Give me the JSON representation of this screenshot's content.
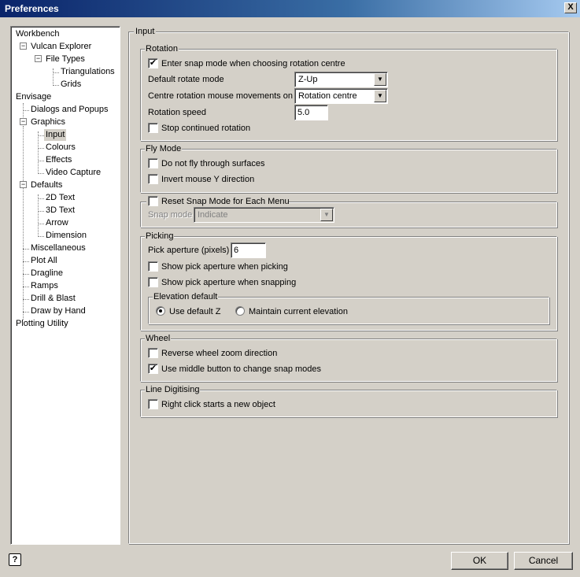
{
  "window": {
    "title": "Preferences",
    "close_glyph": "X"
  },
  "tree": {
    "items": [
      {
        "label": "Workbench"
      },
      {
        "label": "Vulcan Explorer",
        "expander": "−"
      },
      {
        "label": "File Types",
        "expander": "−"
      },
      {
        "label": "Triangulations"
      },
      {
        "label": "Grids"
      },
      {
        "label": "Envisage"
      },
      {
        "label": "Dialogs and Popups"
      },
      {
        "label": "Graphics",
        "expander": "−"
      },
      {
        "label": "Input",
        "selected": true
      },
      {
        "label": "Colours"
      },
      {
        "label": "Effects"
      },
      {
        "label": "Video Capture"
      },
      {
        "label": "Defaults",
        "expander": "−"
      },
      {
        "label": "2D Text"
      },
      {
        "label": "3D Text"
      },
      {
        "label": "Arrow"
      },
      {
        "label": "Dimension"
      },
      {
        "label": "Miscellaneous"
      },
      {
        "label": "Plot All"
      },
      {
        "label": "Dragline"
      },
      {
        "label": "Ramps"
      },
      {
        "label": "Drill & Blast"
      },
      {
        "label": "Draw by Hand"
      },
      {
        "label": "Plotting Utility"
      }
    ]
  },
  "panel": {
    "title": "Input",
    "rotation": {
      "label": "Rotation",
      "snap_mode": {
        "label": "Enter snap mode when choosing rotation centre",
        "checked": true,
        "glyph": "✔"
      },
      "default_rotate_label": "Default rotate mode",
      "default_rotate_value": "Z-Up",
      "centre_rotation_label": "Centre rotation mouse movements on",
      "centre_rotation_value": "Rotation centre",
      "speed_label": "Rotation speed",
      "speed_value": "5.0",
      "stop_continued": {
        "label": "Stop continued rotation",
        "checked": false
      }
    },
    "fly_mode": {
      "label": "Fly Mode",
      "no_fly_through": {
        "label": "Do not fly through surfaces",
        "checked": false
      },
      "invert_y": {
        "label": "Invert mouse Y direction",
        "checked": false
      }
    },
    "reset_snap": {
      "label": "Reset Snap Mode for Each Menu",
      "checked": false,
      "snap_mode_label": "Snap mode",
      "snap_mode_value": "Indicate"
    },
    "picking": {
      "label": "Picking",
      "aperture_label": "Pick aperture (pixels)",
      "aperture_value": "6",
      "show_when_picking": {
        "label": "Show pick aperture when picking",
        "checked": false
      },
      "show_when_snapping": {
        "label": "Show pick aperture when snapping",
        "checked": false
      },
      "elevation": {
        "label": "Elevation default",
        "use_default_z": {
          "label": "Use default  Z",
          "selected": true
        },
        "maintain_current": {
          "label": "Maintain current elevation",
          "selected": false
        }
      }
    },
    "wheel": {
      "label": "Wheel",
      "reverse_zoom": {
        "label": "Reverse wheel zoom direction",
        "checked": false
      },
      "middle_button": {
        "label": "Use middle button to change snap modes",
        "checked": true,
        "glyph": "✔"
      }
    },
    "line_digitising": {
      "label": "Line Digitising",
      "right_click": {
        "label": "Right click starts a new object",
        "checked": false
      }
    }
  },
  "footer": {
    "help_glyph": "?",
    "ok_label": "OK",
    "cancel_label": "Cancel"
  },
  "icons": {
    "dropdown": "▼"
  }
}
